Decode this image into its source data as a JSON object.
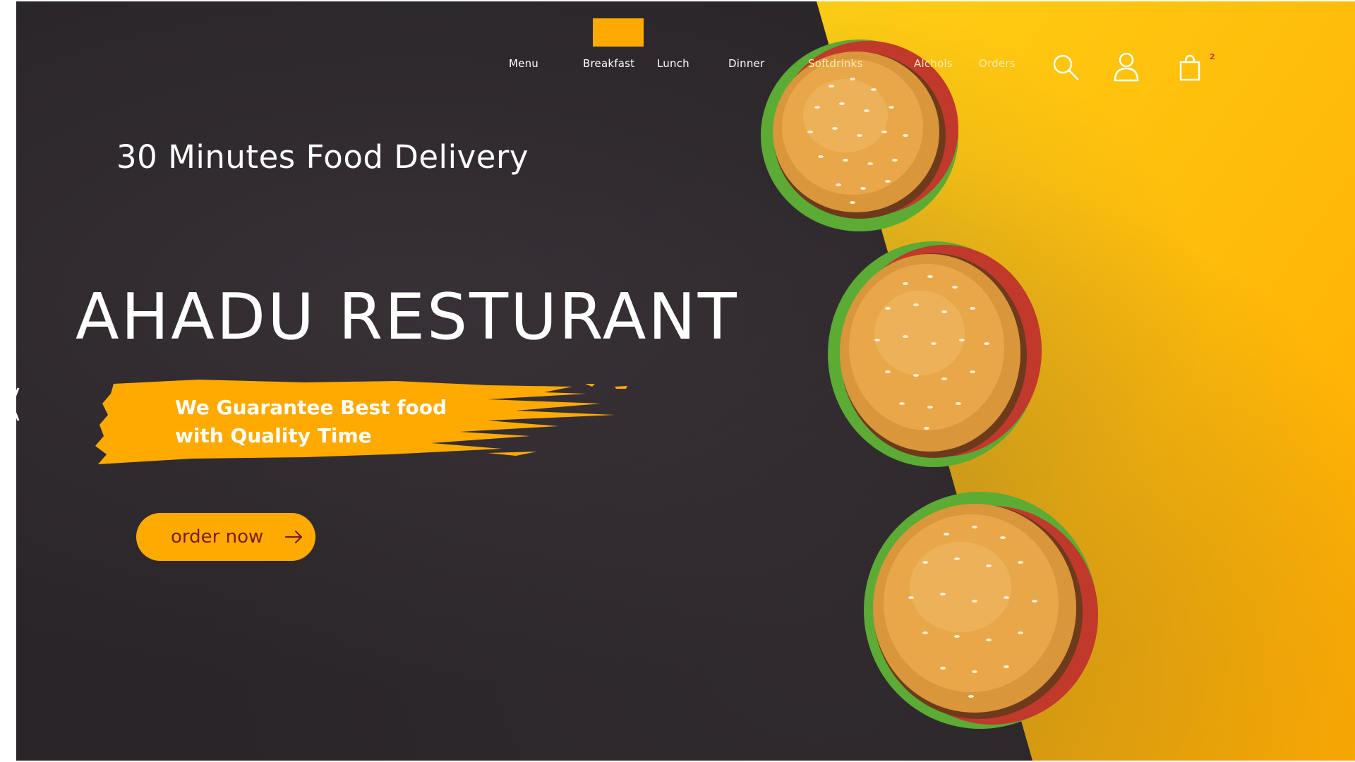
{
  "nav": {
    "items": [
      {
        "label": "Menu"
      },
      {
        "label": "Breakfast"
      },
      {
        "label": "Lunch"
      },
      {
        "label": "Dinner"
      },
      {
        "label": "Softdrinks"
      },
      {
        "label": "Alchols"
      },
      {
        "label": "Orders"
      }
    ],
    "icons": [
      "search-icon",
      "user-icon",
      "cart-icon"
    ],
    "cart_count": "2"
  },
  "hero": {
    "tagline": "30 Minutes Food Delivery",
    "title": "AHADU RESTURANT",
    "guarantee_line1": "We Guarantee Best food",
    "guarantee_line2": "with Quality Time",
    "order_button": "order now"
  },
  "colors": {
    "dark_background": "#2a2529",
    "accent": "#ffaa00",
    "yellow_background": "#ffc107",
    "button_text": "#7a1f0e",
    "text": "#ffffff"
  }
}
